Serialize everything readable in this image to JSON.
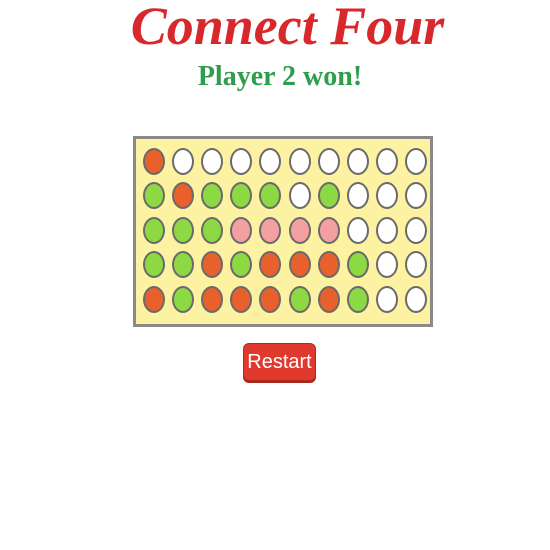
{
  "game": {
    "title": "Connect Four",
    "status": "Player 2 won!"
  },
  "board": {
    "columns": 10,
    "rows": 5,
    "grid": [
      [
        "orange",
        "empty",
        "empty",
        "empty",
        "empty",
        "empty",
        "empty",
        "empty",
        "empty",
        "empty"
      ],
      [
        "green",
        "orange",
        "green",
        "green",
        "green",
        "empty",
        "green",
        "empty",
        "empty",
        "empty"
      ],
      [
        "green",
        "green",
        "green",
        "pink",
        "pink",
        "pink",
        "pink",
        "empty",
        "empty",
        "empty"
      ],
      [
        "green",
        "green",
        "orange",
        "green",
        "orange",
        "orange",
        "orange",
        "green",
        "empty",
        "empty"
      ],
      [
        "orange",
        "green",
        "orange",
        "orange",
        "orange",
        "green",
        "orange",
        "green",
        "empty",
        "empty"
      ]
    ],
    "colors": {
      "orange": "#e8602c",
      "green": "#8dd944",
      "pink": "#f5a0a0",
      "empty": "#ffffff",
      "board_bg": "#fdf2a1",
      "board_border": "#8a8a8a"
    }
  },
  "controls": {
    "restart_label": "Restart"
  }
}
